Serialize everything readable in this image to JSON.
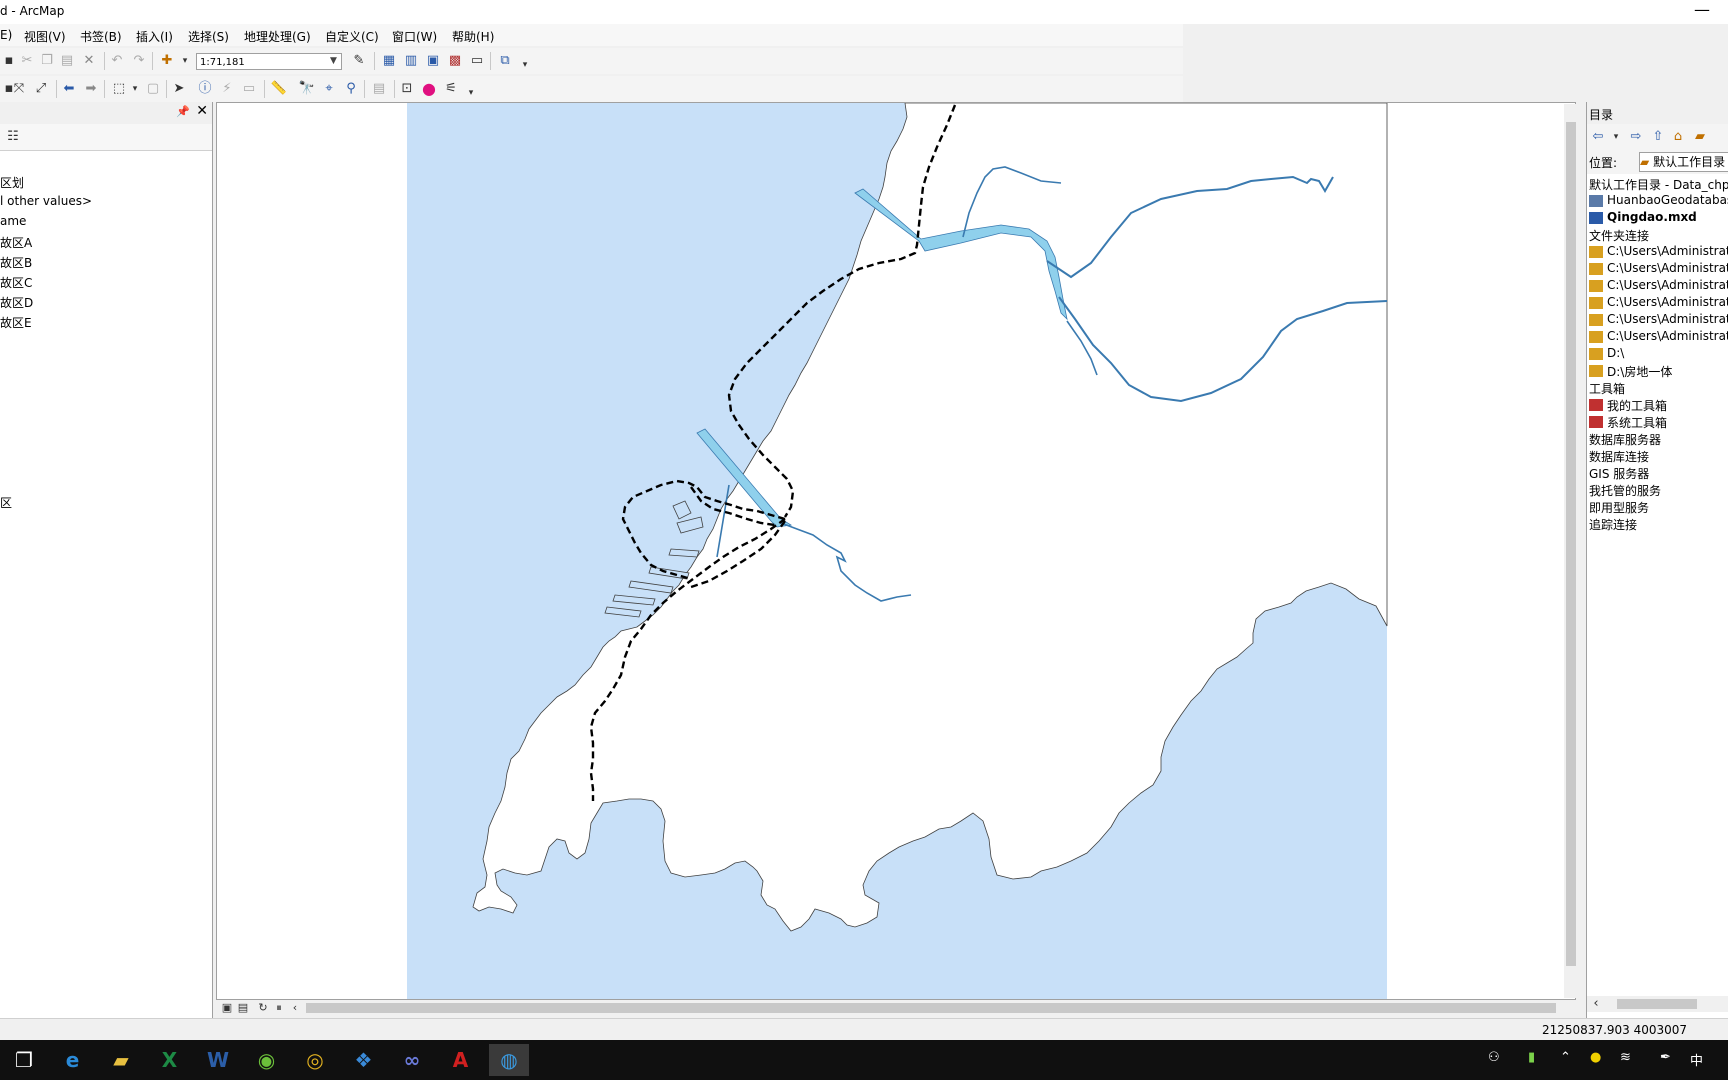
{
  "window": {
    "title": "d - ArcMap",
    "controls": "—"
  },
  "menu": [
    {
      "label": "E)"
    },
    {
      "label": "视图(V)"
    },
    {
      "label": "书签(B)"
    },
    {
      "label": "插入(I)"
    },
    {
      "label": "选择(S)"
    },
    {
      "label": "地理处理(G)"
    },
    {
      "label": "自定义(C)"
    },
    {
      "label": "窗口(W)"
    },
    {
      "label": "帮助(H)"
    }
  ],
  "toolbar": {
    "scale": "1:71,181"
  },
  "toc": {
    "items": [
      {
        "label": "区划"
      },
      {
        "label": "l other values>"
      },
      {
        "label": "ame"
      },
      {
        "label": "故区A"
      },
      {
        "label": "故区B"
      },
      {
        "label": "故区C"
      },
      {
        "label": "故区D"
      },
      {
        "label": "故区E"
      },
      {
        "label": "区"
      }
    ]
  },
  "catalog": {
    "title": "目录",
    "location_label": "位置:",
    "location_value": "默认工作目录",
    "items": [
      {
        "label": "默认工作目录 - Data_chp",
        "icon": "none",
        "bold": false
      },
      {
        "label": "HuanbaoGeodatabase",
        "icon": "database-icon",
        "bold": false
      },
      {
        "label": "Qingdao.mxd",
        "icon": "map-document-icon",
        "bold": true
      },
      {
        "label": "文件夹连接",
        "icon": "none",
        "bold": false
      },
      {
        "label": "C:\\Users\\Administrator",
        "icon": "folder-icon",
        "bold": false
      },
      {
        "label": "C:\\Users\\Administrator",
        "icon": "folder-icon",
        "bold": false
      },
      {
        "label": "C:\\Users\\Administrator",
        "icon": "folder-icon",
        "bold": false
      },
      {
        "label": "C:\\Users\\Administrator",
        "icon": "folder-icon",
        "bold": false
      },
      {
        "label": "C:\\Users\\Administrator",
        "icon": "folder-icon",
        "bold": false
      },
      {
        "label": "C:\\Users\\Administrator",
        "icon": "folder-icon",
        "bold": false
      },
      {
        "label": "D:\\",
        "icon": "folder-icon",
        "bold": false
      },
      {
        "label": "D:\\房地一体",
        "icon": "folder-icon",
        "bold": false
      },
      {
        "label": "工具箱",
        "icon": "none",
        "bold": false
      },
      {
        "label": "我的工具箱",
        "icon": "toolbox-icon",
        "bold": false
      },
      {
        "label": "系统工具箱",
        "icon": "toolbox-icon",
        "bold": false
      },
      {
        "label": "数据库服务器",
        "icon": "none",
        "bold": false
      },
      {
        "label": "数据库连接",
        "icon": "none",
        "bold": false
      },
      {
        "label": "GIS 服务器",
        "icon": "none",
        "bold": false
      },
      {
        "label": "我托管的服务",
        "icon": "none",
        "bold": false
      },
      {
        "label": "即用型服务",
        "icon": "none",
        "bold": false
      },
      {
        "label": "追踪连接",
        "icon": "none",
        "bold": false
      }
    ]
  },
  "status": {
    "coordinates": "21250837.903  4003007"
  },
  "taskbar": {
    "apps": [
      "task-view-icon",
      "edge-icon",
      "file-explorer-icon",
      "excel-icon",
      "word-icon",
      "app-green-icon",
      "chrome-icon",
      "app-blue-icon",
      "app-link-icon",
      "acrobat-icon",
      "arcmap-icon"
    ],
    "tray_ime": "中"
  },
  "colors": {
    "water": "#c8e0f8",
    "river": "#8fd0ec",
    "land": "#ffffff",
    "boundary": "#000000"
  }
}
